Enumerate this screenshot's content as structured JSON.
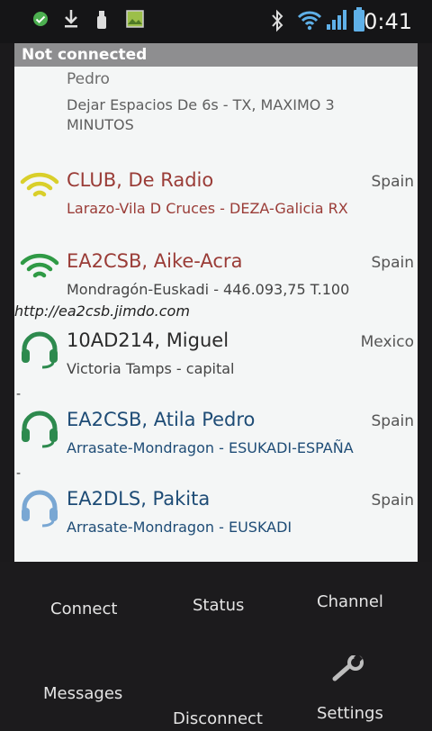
{
  "status_bar": {
    "time": "0:41",
    "icons": [
      "check-circle-icon",
      "download-icon",
      "usb-icon",
      "image-icon",
      "bluetooth-icon",
      "wifi-icon",
      "signal-icon",
      "battery-icon"
    ]
  },
  "connection": {
    "status": "Not connected"
  },
  "channels": {
    "partial_top": {
      "title_fragment": "Pedro",
      "desc": "Dejar Espacios De 6s - TX, MAXIMO 3 MINUTOS"
    },
    "items": [
      {
        "title": "CLUB, De Radio",
        "country": "Spain",
        "desc": "Larazo-Vila D Cruces - DEZA-Galicia RX",
        "icon": "wifi-yellow-icon"
      },
      {
        "title": "EA2CSB, Aike-Acra",
        "country": "Spain",
        "desc": "Mondragón-Euskadi - 446.093,75 T.100",
        "url": "http://ea2csb.jimdo.com",
        "icon": "wifi-green-icon"
      },
      {
        "title": "10AD214, Miguel",
        "country": "Mexico",
        "desc": "Victoria Tamps - capital",
        "icon": "headset-green-icon"
      },
      {
        "title": "EA2CSB, Atila Pedro",
        "country": "Spain",
        "desc": "Arrasate-Mondragon - ESUKADI-ESPAÑA",
        "icon": "headset-green-icon"
      },
      {
        "title": "EA2DLS, Pakita",
        "country": "Spain",
        "desc": "Arrasate-Mondragon - EUSKADI",
        "icon": "headset-blue-icon"
      }
    ]
  },
  "menu": {
    "connect": "Connect",
    "status": "Status",
    "channel": "Channel",
    "messages": "Messages",
    "disconnect": "Disconnect",
    "settings": "Settings"
  },
  "colors": {
    "wifi_yellow": "#d9cf2a",
    "wifi_green": "#2f9a45",
    "headset_green": "#2d8a4e",
    "headset_blue": "#79a7d3",
    "banner_bg": "#8e8e90"
  }
}
